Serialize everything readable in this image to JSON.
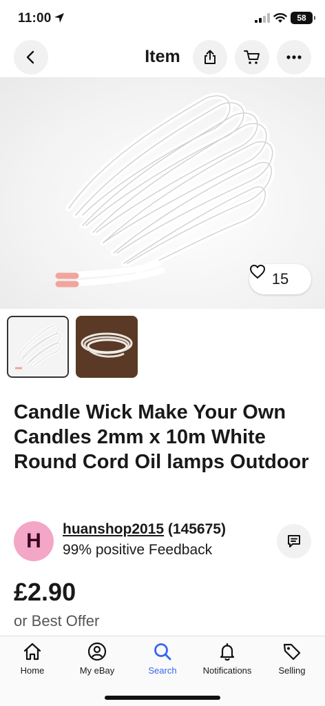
{
  "status_bar": {
    "time": "11:00",
    "battery": "58"
  },
  "header": {
    "title": "Item",
    "back_icon": "chevron-left-icon",
    "share_icon": "share-icon",
    "cart_icon": "cart-icon",
    "more_icon": "more-icon"
  },
  "hero": {
    "like_count": "15",
    "like_icon": "heart-icon"
  },
  "item": {
    "title": "Candle Wick Make Your Own Candles 2mm x 10m White Round Cord Oil lamps Outdoor",
    "price": "£2.90",
    "offer_text": "or Best Offer"
  },
  "seller": {
    "avatar_letter": "H",
    "name": "huanshop2015",
    "count": "(145675)",
    "feedback": "99% positive Feedback"
  },
  "nav": {
    "items": [
      {
        "label": "Home",
        "icon": "home-icon"
      },
      {
        "label": "My eBay",
        "icon": "user-icon"
      },
      {
        "label": "Search",
        "icon": "search-icon"
      },
      {
        "label": "Notifications",
        "icon": "bell-icon"
      },
      {
        "label": "Selling",
        "icon": "tag-icon"
      }
    ],
    "active": "Search"
  },
  "colors": {
    "accent": "#3665f3",
    "avatar_bg": "#f4a6c6",
    "text": "#191919"
  }
}
